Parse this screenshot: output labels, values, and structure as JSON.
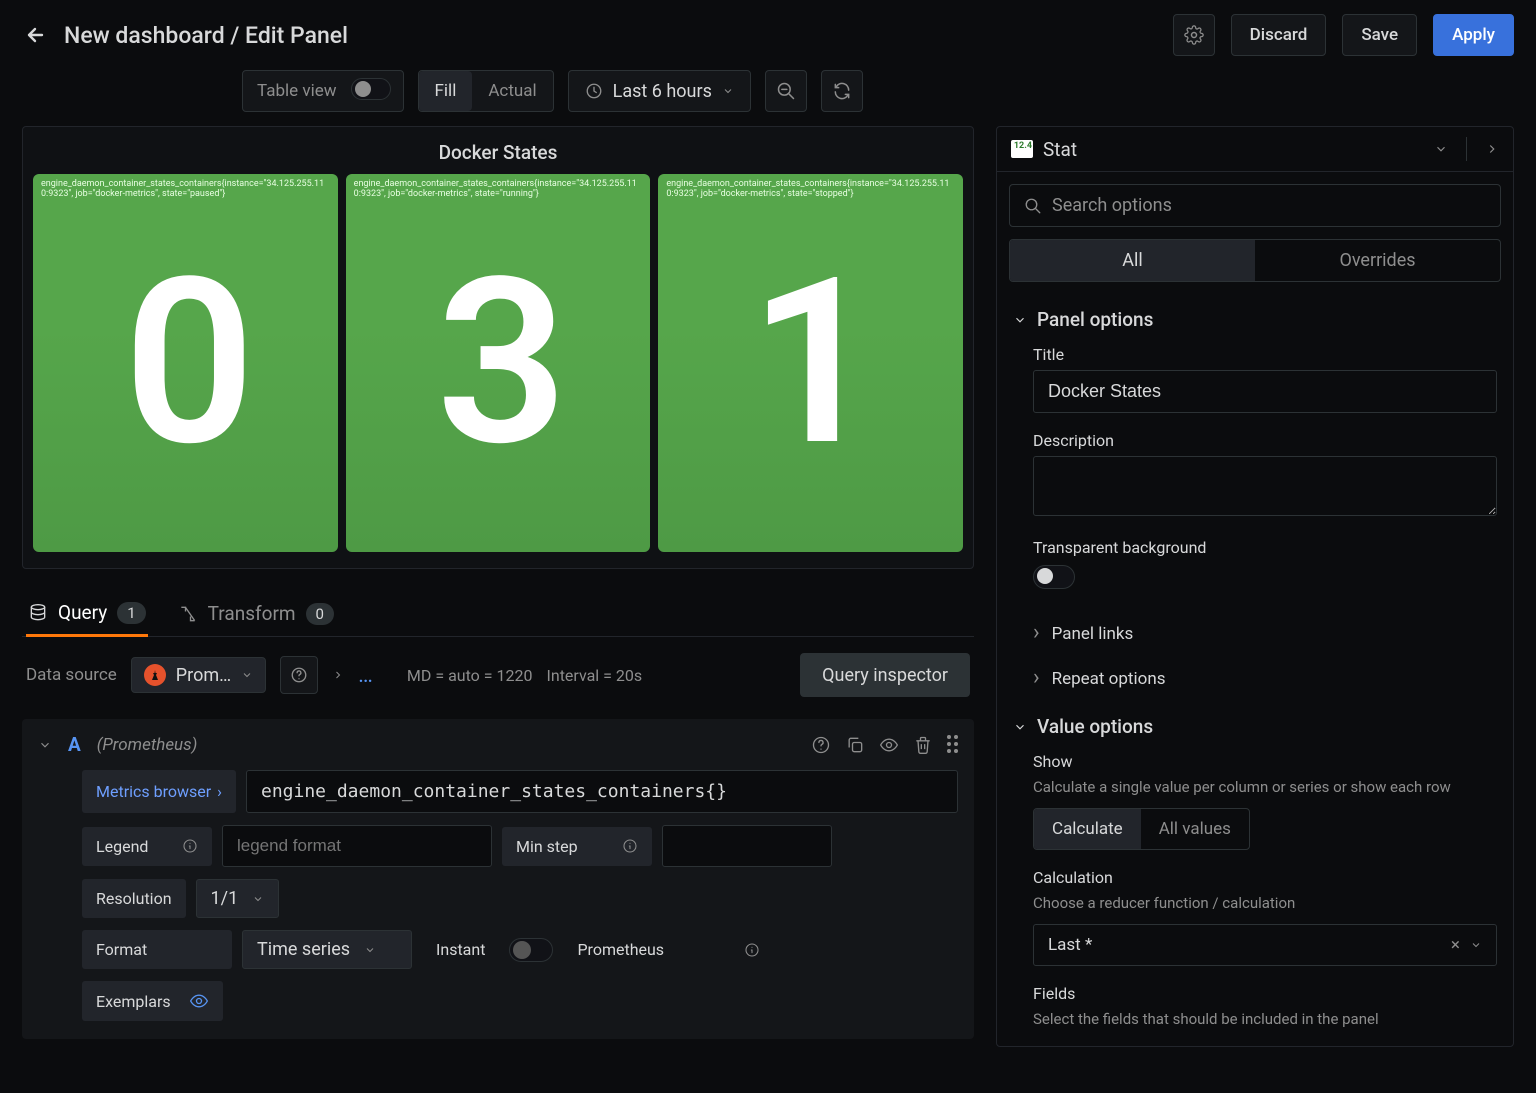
{
  "header": {
    "title": "New dashboard / Edit Panel",
    "discard": "Discard",
    "save": "Save",
    "apply": "Apply"
  },
  "toolbar": {
    "table_view": "Table view",
    "fill": "Fill",
    "actual": "Actual",
    "time_range": "Last 6 hours"
  },
  "panel": {
    "title": "Docker States",
    "stats": [
      {
        "label": "engine_daemon_container_states_containers{instance=\"34.125.255.110:9323\", job=\"docker-metrics\", state=\"paused\"}",
        "value": "0"
      },
      {
        "label": "engine_daemon_container_states_containers{instance=\"34.125.255.110:9323\", job=\"docker-metrics\", state=\"running\"}",
        "value": "3"
      },
      {
        "label": "engine_daemon_container_states_containers{instance=\"34.125.255.110:9323\", job=\"docker-metrics\", state=\"stopped\"}",
        "value": "1"
      }
    ]
  },
  "tabs": {
    "query": "Query",
    "query_count": "1",
    "transform": "Transform",
    "transform_count": "0"
  },
  "query_header": {
    "data_source_label": "Data source",
    "data_source_value": "Prom…",
    "dots": "…",
    "md": "MD = auto = 1220",
    "interval": "Interval = 20s",
    "inspector": "Query inspector"
  },
  "query_a": {
    "letter": "A",
    "source": "(Prometheus)",
    "metrics_browser": "Metrics browser",
    "expr": "engine_daemon_container_states_containers{}",
    "legend_label": "Legend",
    "legend_placeholder": "legend format",
    "min_step_label": "Min step",
    "resolution_label": "Resolution",
    "resolution_value": "1/1",
    "format_label": "Format",
    "format_value": "Time series",
    "instant_label": "Instant",
    "prometheus_label": "Prometheus",
    "exemplars_label": "Exemplars"
  },
  "side": {
    "viz_name": "Stat",
    "viz_badge": "12.4",
    "search_placeholder": "Search options",
    "tab_all": "All",
    "tab_overrides": "Overrides",
    "panel_options": "Panel options",
    "title_label": "Title",
    "title_value": "Docker States",
    "description_label": "Description",
    "transparent_label": "Transparent background",
    "panel_links": "Panel links",
    "repeat_options": "Repeat options",
    "value_options": "Value options",
    "show_label": "Show",
    "show_desc": "Calculate a single value per column or series or show each row",
    "show_calc": "Calculate",
    "show_all": "All values",
    "calculation_label": "Calculation",
    "calculation_desc": "Choose a reducer function / calculation",
    "calculation_value": "Last *",
    "fields_label": "Fields",
    "fields_desc": "Select the fields that should be included in the panel"
  },
  "chart_data": {
    "type": "table",
    "title": "Docker States",
    "series": [
      {
        "name": "paused",
        "value": 0
      },
      {
        "name": "running",
        "value": 3
      },
      {
        "name": "stopped",
        "value": 1
      }
    ]
  }
}
